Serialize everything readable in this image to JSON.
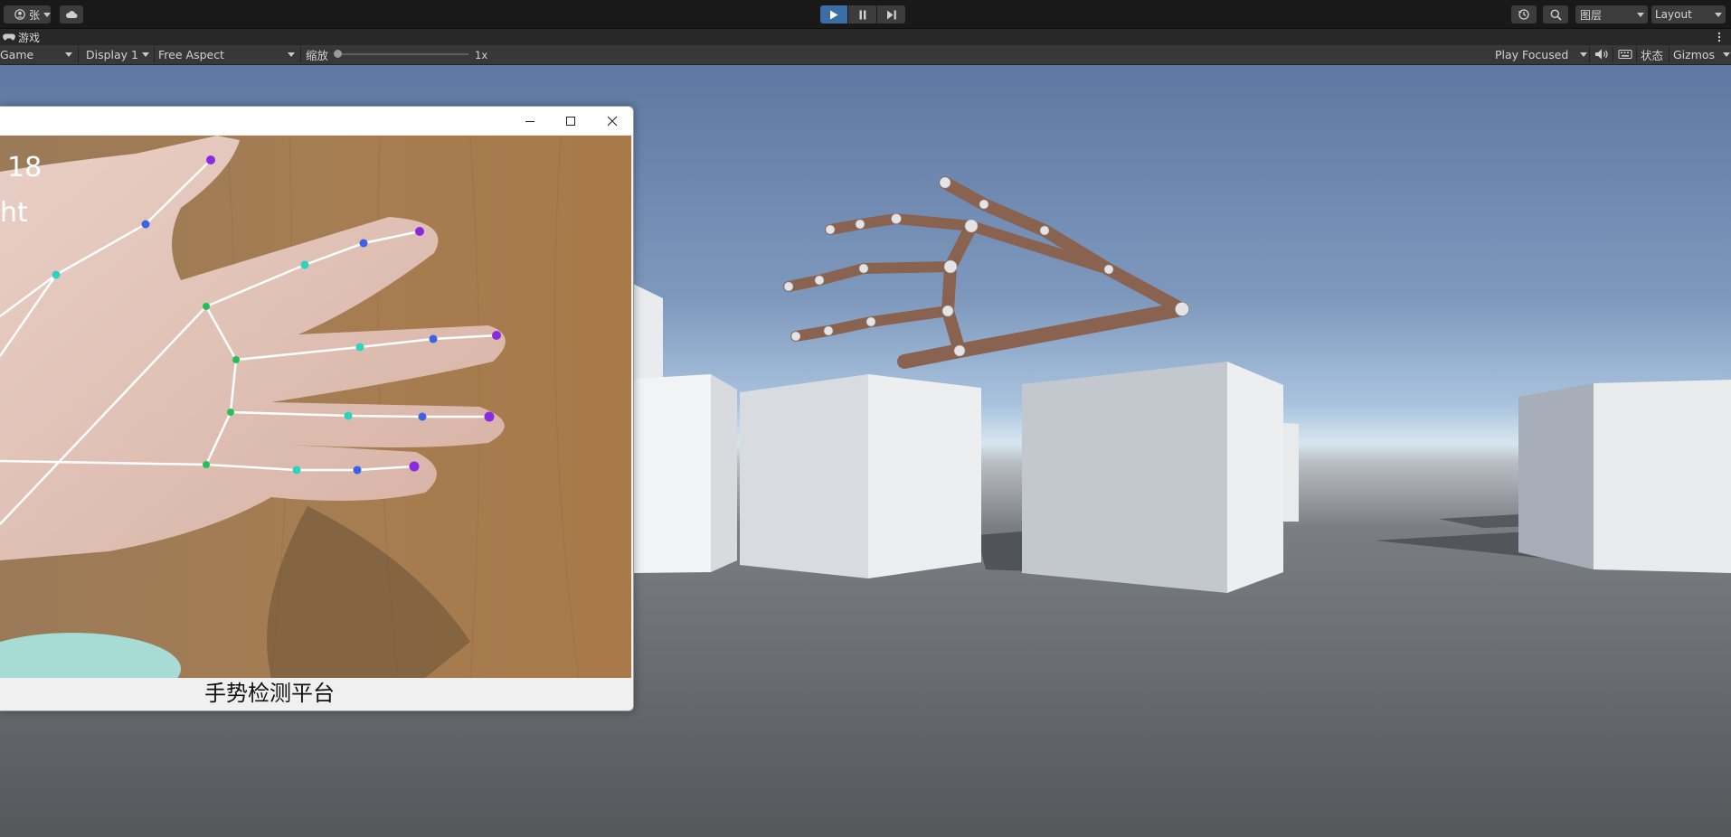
{
  "toolbar": {
    "account_label": "张",
    "play_state": "playing",
    "layers_label": "图层",
    "layout_label": "Layout"
  },
  "tab": {
    "label": "游戏"
  },
  "gamebar": {
    "mode": "Game",
    "display": "Display 1",
    "aspect": "Free Aspect",
    "scale_label": "缩放",
    "scale_value": "1x",
    "scale_fraction": 0.0,
    "play_focus": "Play Focused",
    "stats_label": "状态",
    "gizmos_label": "Gizmos"
  },
  "window": {
    "hud_line1": "18",
    "hud_line2": "ht",
    "caption": "手势检测平台"
  },
  "colors": {
    "toolbar_bg": "#191919",
    "play_active": "#4c7fb5",
    "sky_top": "#5f7aa5",
    "ground": "#6a6c71",
    "robot_hand": "#8a6250",
    "landmark_wrist": "#23c05a",
    "landmark_mid": "#2ed3c0",
    "landmark_upper": "#3c62e6",
    "landmark_tip": "#8a2be2"
  }
}
